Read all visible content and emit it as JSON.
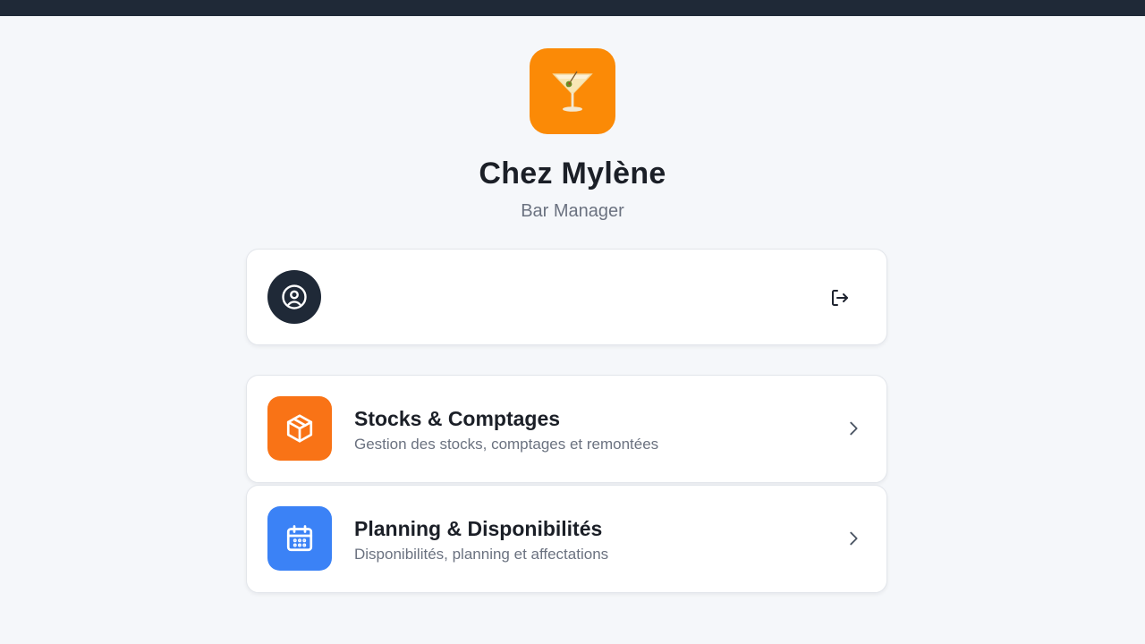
{
  "app": {
    "name": "Chez Mylène",
    "subtitle": "Bar Manager",
    "logo_icon": "cocktail-glass-icon",
    "accent_color": "#fb8a06"
  },
  "user_card": {
    "avatar_icon": "user-circle-icon",
    "logout_icon": "logout-icon"
  },
  "modules": [
    {
      "title": "Stocks & Comptages",
      "description": "Gestion des stocks, comptages et remontées",
      "icon": "package-icon",
      "color": "#f97316"
    },
    {
      "title": "Planning & Disponibilités",
      "description": "Disponibilités, planning et affectations",
      "icon": "calendar-icon",
      "color": "#3b82f6"
    }
  ]
}
